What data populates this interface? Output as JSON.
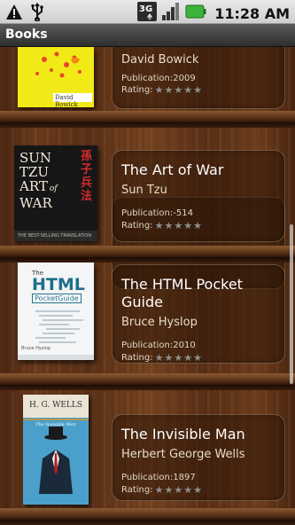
{
  "status_bar": {
    "time": "11:28 AM",
    "network_label": "3G",
    "icons": [
      "warning-icon",
      "usb-icon",
      "3g-icon",
      "signal-icon",
      "battery-icon"
    ]
  },
  "app": {
    "title": "Books"
  },
  "books": [
    {
      "title": "",
      "author": "David Bowick",
      "publication_label": "Publication:",
      "publication": "2009",
      "rating_label": "Rating:",
      "rating": 0,
      "cover_text": "David Bowick"
    },
    {
      "title": "The Art of War",
      "author": "Sun Tzu",
      "publication_label": "Publication:",
      "publication": "-514",
      "rating_label": "Rating:",
      "rating": 0,
      "cover_text": {
        "line1": "SUN",
        "line2": "TZU",
        "line3": "ART",
        "line4": "of",
        "line5": "WAR",
        "chinese": "孫子兵法",
        "tagline": "THE BEST-SELLING TRANSLATION"
      }
    },
    {
      "title": "The HTML Pocket Guide",
      "author": "Bruce Hyslop",
      "publication_label": "Publication:",
      "publication": "2010",
      "rating_label": "Rating:",
      "rating": 0,
      "cover_text": {
        "the": "The",
        "html": "HTML",
        "pocket": "PocketGuide",
        "author": "Bruce Hyslop"
      }
    },
    {
      "title": "The Invisible Man",
      "author": "Herbert George Wells",
      "publication_label": "Publication:",
      "publication": "1897",
      "rating_label": "Rating:",
      "rating": 0,
      "cover_text": {
        "name": "H. G. WELLS",
        "title": "The Invisible Man"
      }
    }
  ],
  "colors": {
    "star_inactive": "#8f8f8f",
    "title_bar": "#3a3a3a",
    "battery_green": "#3cb33c"
  }
}
